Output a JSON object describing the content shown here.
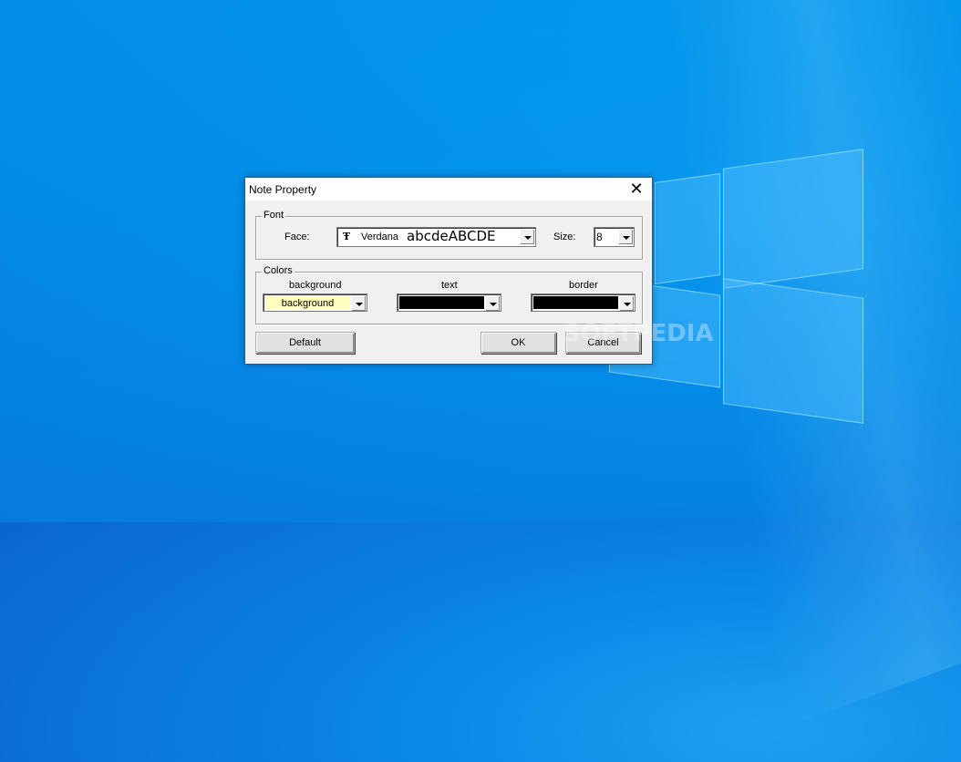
{
  "dialog": {
    "title": "Note Property",
    "close_icon": "close-icon"
  },
  "font_group": {
    "label": "Font",
    "face_label": "Face:",
    "face_icon": "truetype-font-icon",
    "face_icon_glyph": "Ŧ",
    "face_value": "Verdana",
    "face_sample": "abcdeABCDE",
    "size_label": "Size:",
    "size_value": "8"
  },
  "colors_group": {
    "label": "Colors",
    "background": {
      "label": "background",
      "value_text": "background",
      "color": "#ffffc0"
    },
    "text": {
      "label": "text",
      "value_text": "",
      "color": "#000000"
    },
    "border": {
      "label": "border",
      "value_text": "",
      "color": "#000000"
    }
  },
  "buttons": {
    "default": "Default",
    "ok": "OK",
    "cancel": "Cancel"
  },
  "watermark": "SOFTPEDIA"
}
